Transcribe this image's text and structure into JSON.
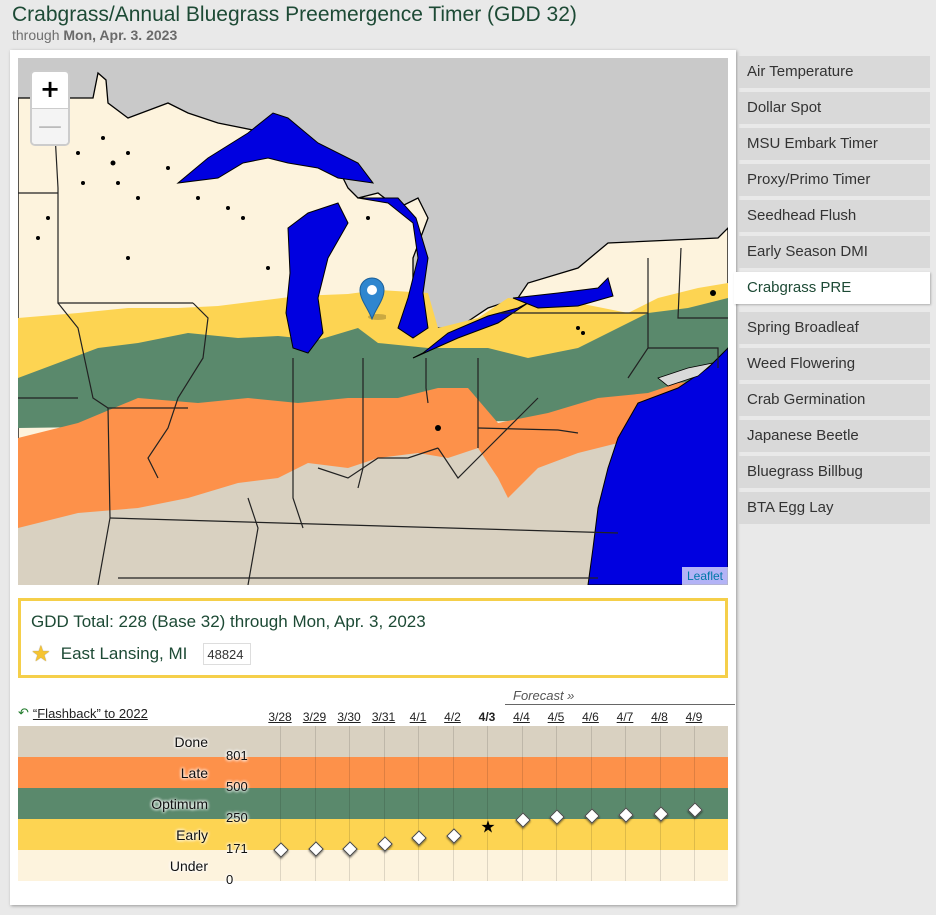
{
  "header": {
    "title": "Crabgrass/Annual Bluegrass Preemergence Timer (GDD 32)",
    "subtitle_prefix": "through",
    "subtitle_date": "Mon, Apr. 3. 2023"
  },
  "map": {
    "zoom_in_label": "+",
    "zoom_out_label": "—",
    "attribution": "Leaflet",
    "marker_icon": "map-pin-icon",
    "colors": {
      "background_land_outside": "#c9c9c9",
      "water": "#0000e0",
      "under": "#fdf3dd",
      "early": "#fdd452",
      "optimum": "#5a896c",
      "late": "#fd914a",
      "done": "#d9d1c1"
    }
  },
  "gdd": {
    "summary": "GDD Total: 228 (Base 32) through Mon, Apr. 3, 2023",
    "location_icon": "star-icon",
    "location": "East Lansing, MI",
    "zip_value": "48824"
  },
  "flashback": {
    "icon": "undo-arrow-icon",
    "label": "“Flashback” to 2022"
  },
  "forecast_label": "Forecast »",
  "chart_data": {
    "type": "scatter",
    "title": "",
    "xlabel": "",
    "ylabel": "",
    "categories": [
      "3/28",
      "3/29",
      "3/30",
      "3/31",
      "4/1",
      "4/2",
      "4/3",
      "4/4",
      "4/5",
      "4/6",
      "4/7",
      "4/8",
      "4/9"
    ],
    "current_date": "4/3",
    "forecast_start": "4/4",
    "values": [
      172,
      174,
      174,
      187,
      202,
      207,
      228,
      248,
      268,
      276,
      284,
      292,
      322
    ],
    "bands": [
      {
        "name": "Done",
        "min": 801,
        "max": null,
        "color": "#d9d1c1"
      },
      {
        "name": "Late",
        "min": 500,
        "max": 801,
        "color": "#fd914a"
      },
      {
        "name": "Optimum",
        "min": 250,
        "max": 500,
        "color": "#5a896c"
      },
      {
        "name": "Early",
        "min": 171,
        "max": 250,
        "color": "#fdd452"
      },
      {
        "name": "Under",
        "min": 0,
        "max": 171,
        "color": "#fdf3dd"
      }
    ],
    "thresholds": [
      "801",
      "500",
      "250",
      "171",
      "0"
    ],
    "markers": {
      "observed": "diamond",
      "current": "star",
      "forecast": "diamond"
    }
  },
  "sidebar": {
    "items": [
      {
        "label": "Air Temperature",
        "active": false
      },
      {
        "label": "Dollar Spot",
        "active": false
      },
      {
        "label": "MSU Embark Timer",
        "active": false
      },
      {
        "label": "Proxy/Primo Timer",
        "active": false
      },
      {
        "label": "Seedhead Flush",
        "active": false
      },
      {
        "label": "Early Season DMI",
        "active": false
      },
      {
        "label": "Crabgrass PRE",
        "active": true
      },
      {
        "label": "Spring Broadleaf",
        "active": false
      },
      {
        "label": "Weed Flowering",
        "active": false
      },
      {
        "label": "Crab Germination",
        "active": false
      },
      {
        "label": "Japanese Beetle",
        "active": false
      },
      {
        "label": "Bluegrass Billbug",
        "active": false
      },
      {
        "label": "BTA Egg Lay",
        "active": false
      }
    ]
  }
}
